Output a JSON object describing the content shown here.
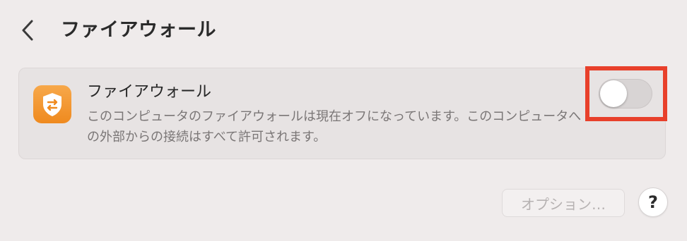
{
  "header": {
    "back_icon": "chevron-left-icon",
    "title": "ファイアウォール"
  },
  "firewall_card": {
    "icon": "shield-arrows-icon",
    "icon_color": "#f39a2e",
    "title": "ファイアウォール",
    "description": "このコンピュータのファイアウォールは現在オフになっています。このコンピュータへの外部からの接続はすべて許可されます。",
    "toggle_on": false
  },
  "footer": {
    "options_label": "オプション…",
    "options_enabled": false,
    "help_label": "?"
  },
  "highlight_color": "#e8402b"
}
